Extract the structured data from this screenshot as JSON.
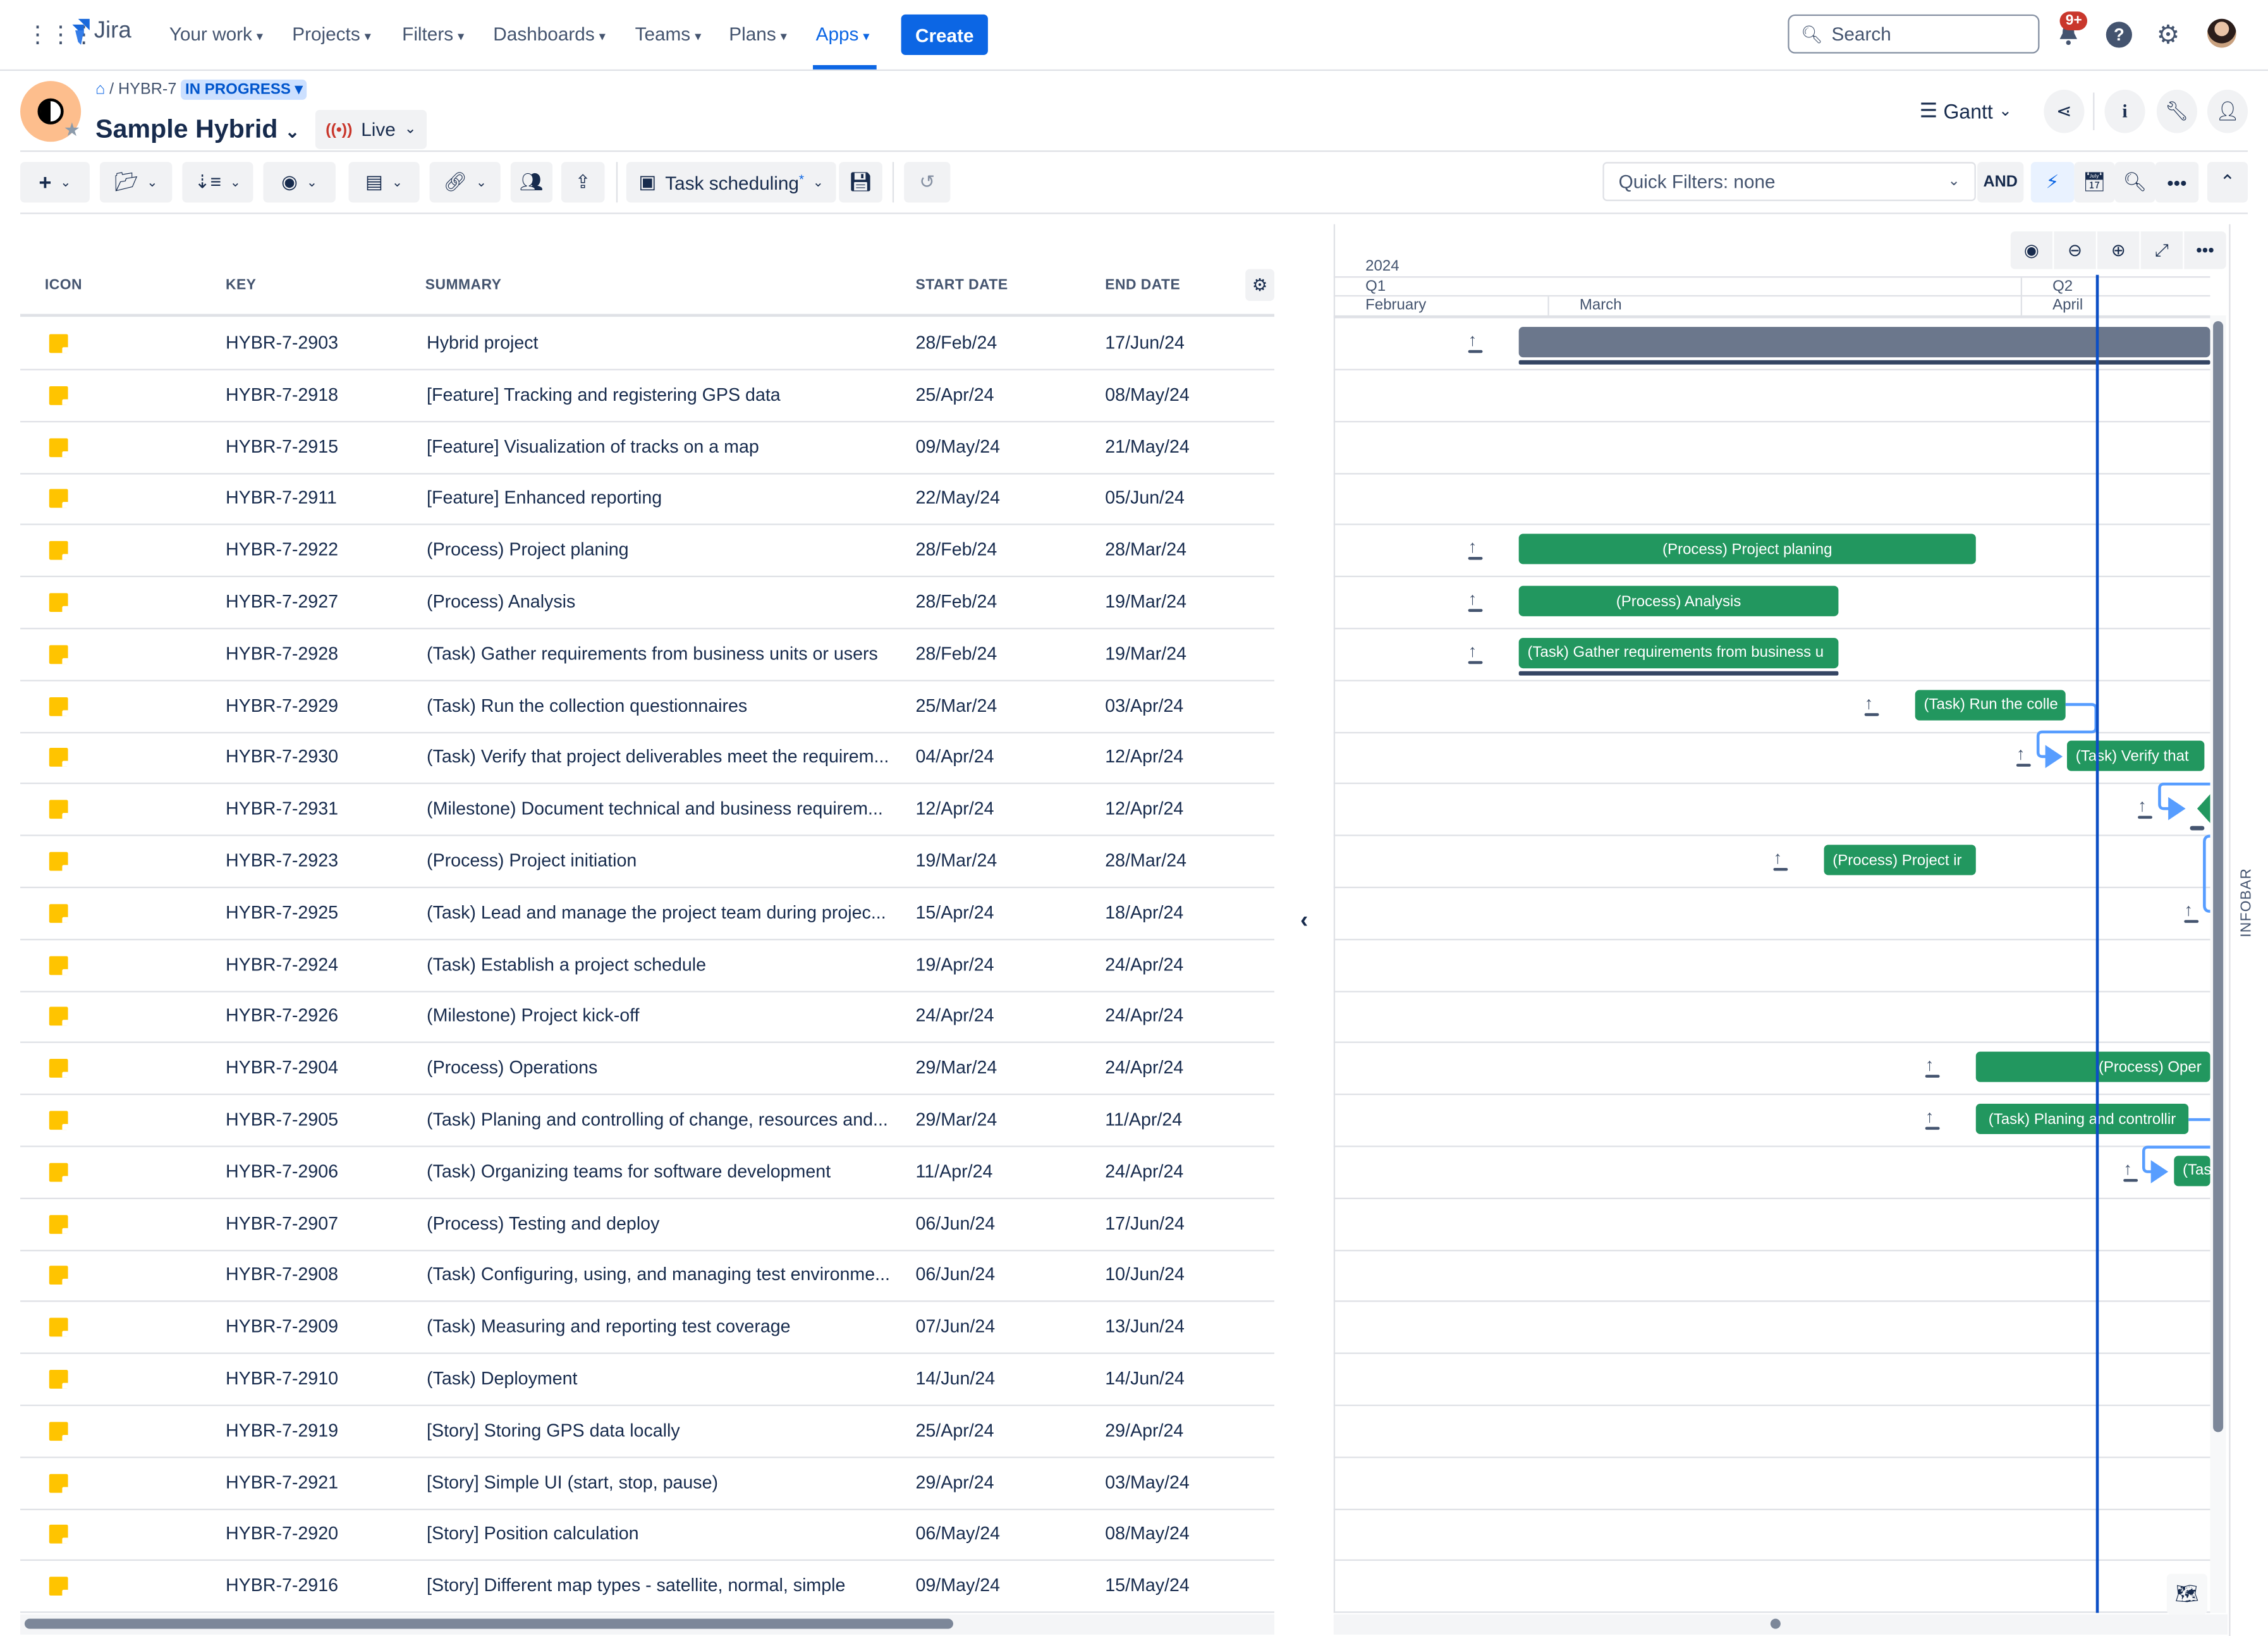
{
  "nav": {
    "app_name": "Jira",
    "items": [
      {
        "label": "Your work",
        "active": false
      },
      {
        "label": "Projects",
        "active": false
      },
      {
        "label": "Filters",
        "active": false
      },
      {
        "label": "Dashboards",
        "active": false
      },
      {
        "label": "Teams",
        "active": false
      },
      {
        "label": "Plans",
        "active": false
      },
      {
        "label": "Apps",
        "active": true
      }
    ],
    "create_label": "Create",
    "search_placeholder": "Search",
    "notifications_badge": "9+"
  },
  "header": {
    "breadcrumb_key": "HYBR-7",
    "status": "IN PROGRESS",
    "title": "Sample Hybrid",
    "live_label": "Live",
    "view_label": "Gantt"
  },
  "toolbar": {
    "view_preset_label": "Task scheduling",
    "view_preset_modified": "*",
    "quick_filters": "Quick Filters: none",
    "and_label": "AND"
  },
  "table": {
    "columns": [
      "ICON",
      "KEY",
      "SUMMARY",
      "START DATE",
      "END DATE"
    ],
    "rows": [
      {
        "key": "HYBR-7-2903",
        "summary": "Hybrid project",
        "start": "28/Feb/24",
        "end": "17/Jun/24"
      },
      {
        "key": "HYBR-7-2918",
        "summary": "[Feature] Tracking and registering GPS data",
        "start": "25/Apr/24",
        "end": "08/May/24"
      },
      {
        "key": "HYBR-7-2915",
        "summary": "[Feature] Visualization of tracks on a map",
        "start": "09/May/24",
        "end": "21/May/24"
      },
      {
        "key": "HYBR-7-2911",
        "summary": "[Feature] Enhanced reporting",
        "start": "22/May/24",
        "end": "05/Jun/24"
      },
      {
        "key": "HYBR-7-2922",
        "summary": "(Process) Project planing",
        "start": "28/Feb/24",
        "end": "28/Mar/24"
      },
      {
        "key": "HYBR-7-2927",
        "summary": "(Process) Analysis",
        "start": "28/Feb/24",
        "end": "19/Mar/24"
      },
      {
        "key": "HYBR-7-2928",
        "summary": "(Task) Gather requirements from business units or users",
        "start": "28/Feb/24",
        "end": "19/Mar/24"
      },
      {
        "key": "HYBR-7-2929",
        "summary": "(Task) Run the collection questionnaires",
        "start": "25/Mar/24",
        "end": "03/Apr/24"
      },
      {
        "key": "HYBR-7-2930",
        "summary": "(Task) Verify that project deliverables meet the requirem...",
        "start": "04/Apr/24",
        "end": "12/Apr/24"
      },
      {
        "key": "HYBR-7-2931",
        "summary": "(Milestone) Document technical and business requirem...",
        "start": "12/Apr/24",
        "end": "12/Apr/24"
      },
      {
        "key": "HYBR-7-2923",
        "summary": "(Process) Project initiation",
        "start": "19/Mar/24",
        "end": "28/Mar/24"
      },
      {
        "key": "HYBR-7-2925",
        "summary": "(Task) Lead and manage the project team during projec...",
        "start": "15/Apr/24",
        "end": "18/Apr/24"
      },
      {
        "key": "HYBR-7-2924",
        "summary": "(Task) Establish a project schedule",
        "start": "19/Apr/24",
        "end": "24/Apr/24"
      },
      {
        "key": "HYBR-7-2926",
        "summary": "(Milestone) Project kick-off",
        "start": "24/Apr/24",
        "end": "24/Apr/24"
      },
      {
        "key": "HYBR-7-2904",
        "summary": "(Process) Operations",
        "start": "29/Mar/24",
        "end": "24/Apr/24"
      },
      {
        "key": "HYBR-7-2905",
        "summary": "(Task) Planing and controlling of change, resources and...",
        "start": "29/Mar/24",
        "end": "11/Apr/24"
      },
      {
        "key": "HYBR-7-2906",
        "summary": "(Task) Organizing teams for software development",
        "start": "11/Apr/24",
        "end": "24/Apr/24"
      },
      {
        "key": "HYBR-7-2907",
        "summary": "(Process) Testing and deploy",
        "start": "06/Jun/24",
        "end": "17/Jun/24"
      },
      {
        "key": "HYBR-7-2908",
        "summary": "(Task) Configuring, using, and managing test environme...",
        "start": "06/Jun/24",
        "end": "10/Jun/24"
      },
      {
        "key": "HYBR-7-2909",
        "summary": "(Task) Measuring and reporting test coverage",
        "start": "07/Jun/24",
        "end": "13/Jun/24"
      },
      {
        "key": "HYBR-7-2910",
        "summary": "(Task) Deployment",
        "start": "14/Jun/24",
        "end": "14/Jun/24"
      },
      {
        "key": "HYBR-7-2919",
        "summary": "[Story] Storing GPS data locally",
        "start": "25/Apr/24",
        "end": "29/Apr/24"
      },
      {
        "key": "HYBR-7-2921",
        "summary": "[Story] Simple UI (start, stop, pause)",
        "start": "29/Apr/24",
        "end": "03/May/24"
      },
      {
        "key": "HYBR-7-2920",
        "summary": "[Story] Position calculation",
        "start": "06/May/24",
        "end": "08/May/24"
      },
      {
        "key": "HYBR-7-2916",
        "summary": "[Story] Different map types - satellite, normal, simple",
        "start": "09/May/24",
        "end": "15/May/24"
      }
    ]
  },
  "gantt": {
    "year": "2024",
    "quarters": [
      "Q1",
      "Q2"
    ],
    "months": [
      "February",
      "March",
      "April"
    ],
    "bars": [
      {
        "row": 0,
        "label": "",
        "type": "summary"
      },
      {
        "row": 4,
        "label": "(Process) Project planing",
        "type": "task"
      },
      {
        "row": 5,
        "label": "(Process) Analysis",
        "type": "task"
      },
      {
        "row": 6,
        "label": "(Task) Gather requirements from business u",
        "type": "task"
      },
      {
        "row": 7,
        "label": "(Task) Run the colle",
        "type": "task"
      },
      {
        "row": 8,
        "label": "(Task) Verify that",
        "type": "task"
      },
      {
        "row": 10,
        "label": "(Process) Project ir",
        "type": "task"
      },
      {
        "row": 14,
        "label": "(Process) Oper",
        "type": "task"
      },
      {
        "row": 15,
        "label": "(Task) Planing and controllir",
        "type": "task"
      },
      {
        "row": 16,
        "label": "(Tas",
        "type": "task"
      }
    ],
    "infobar_label": "INFOBAR"
  },
  "colors": {
    "accent": "#0c66e4",
    "bar_green": "#22975f",
    "bar_summary": "#6b778c",
    "issue_icon": "#ffc400",
    "today_line": "#0c4fc5",
    "dependency": "#579dff"
  }
}
